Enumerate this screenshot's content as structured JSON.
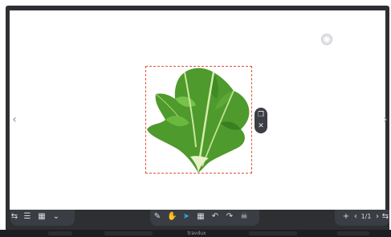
{
  "nav": {
    "prev_icon": "chevron-left-icon",
    "next_icon": "chevron-right-icon"
  },
  "object_menu": {
    "duplicate_icon": "copy-icon",
    "close_icon": "close-icon"
  },
  "toolbar_left": [
    "swap-icon",
    "list-icon",
    "grid-icon",
    "chevron-down-icon"
  ],
  "toolbar_center": [
    "pen-icon",
    "hand-icon",
    "select-icon",
    "apps-icon",
    "undo-icon",
    "redo-icon",
    "clean-icon"
  ],
  "toolbar_right": {
    "add_icon": "plus-icon",
    "prev_icon": "chevron-left-icon",
    "page_indicator": "1/1",
    "next_icon": "chevron-right-icon",
    "swap_icon": "swap-icon"
  },
  "taskbar": {
    "title": "travdux"
  },
  "colors": {
    "selection": "#e1543a",
    "active_tool": "#27a9e1",
    "bezel": "#2d2f33"
  }
}
